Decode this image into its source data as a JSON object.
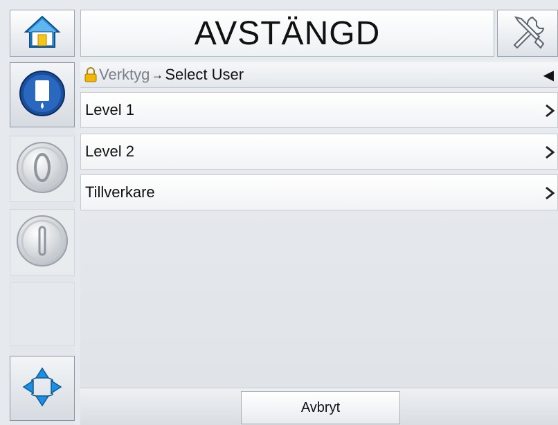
{
  "header": {
    "title": "AVSTÄNGD",
    "home_icon": "home-icon",
    "tools_icon": "tools-icon"
  },
  "sidebar": {
    "buttons": [
      {
        "name": "ink-status-button",
        "icon": "ink-status-icon"
      },
      {
        "name": "start-button",
        "icon": "power-on-icon"
      },
      {
        "name": "stop-button",
        "icon": "power-off-icon"
      },
      {
        "name": "empty-slot",
        "icon": ""
      },
      {
        "name": "navigation-button",
        "icon": "navigation-arrows-icon"
      }
    ]
  },
  "breadcrumb": {
    "parent": "Verktyg",
    "separator": "→",
    "current": "Select User",
    "back": "◀"
  },
  "users": {
    "items": [
      {
        "label": "Level 1"
      },
      {
        "label": "Level 2"
      },
      {
        "label": "Tillverkare"
      }
    ]
  },
  "footer": {
    "cancel_label": "Avbryt"
  },
  "colors": {
    "accent_blue": "#1f5fb3",
    "home_roof": "#1e88d6",
    "home_door": "#f5c518"
  }
}
